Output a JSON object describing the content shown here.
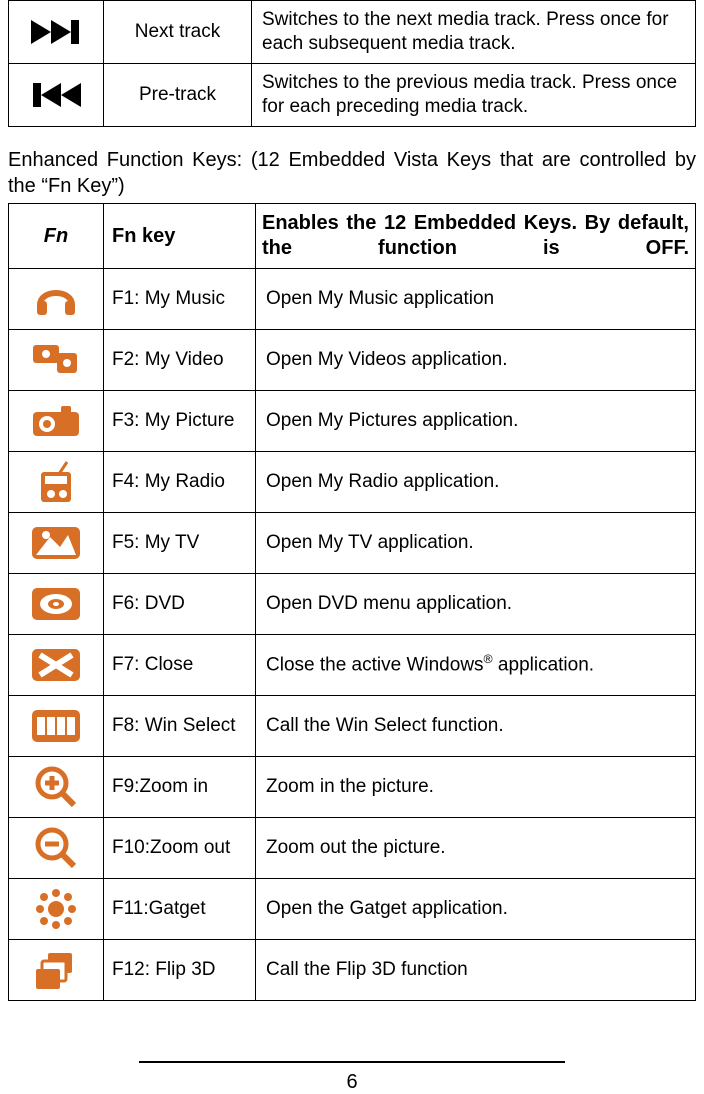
{
  "media_rows": [
    {
      "name": "Next track",
      "desc": "Switches to the next media track. Press once for each subsequent media track."
    },
    {
      "name": "Pre-track",
      "desc": "Switches to the previous media track. Press once for each preceding media track."
    }
  ],
  "section_intro": "Enhanced Function Keys: (12 Embedded Vista Keys that are controlled by the “Fn Key”)",
  "fn_header": {
    "col1": "Fn",
    "col2": "Fn key",
    "col3": "Enables the 12 Embedded Keys. By default, the function is OFF."
  },
  "fn_rows": [
    {
      "name": "F1: My Music",
      "desc": "Open My Music application"
    },
    {
      "name": "F2: My Video",
      "desc": "Open My Videos application."
    },
    {
      "name": "F3: My Picture",
      "desc": "Open My Pictures application."
    },
    {
      "name": "F4: My Radio",
      "desc": "Open My Radio application."
    },
    {
      "name": "F5: My TV",
      "desc": "Open My TV application."
    },
    {
      "name": "F6: DVD",
      "desc": "Open DVD menu application."
    },
    {
      "name": "F7: Close",
      "desc_html": "Close the active Windows<sup>&reg;</sup> application."
    },
    {
      "name": "F8: Win Select",
      "desc": "Call the Win Select function."
    },
    {
      "name": "F9:Zoom in",
      "desc": "Zoom in the picture."
    },
    {
      "name": "F10:Zoom out",
      "desc": "Zoom out the picture."
    },
    {
      "name": "F11:Gatget",
      "desc": "Open the Gatget application."
    },
    {
      "name": "F12: Flip 3D",
      "desc": "Call the Flip 3D function"
    }
  ],
  "page_number": "6"
}
